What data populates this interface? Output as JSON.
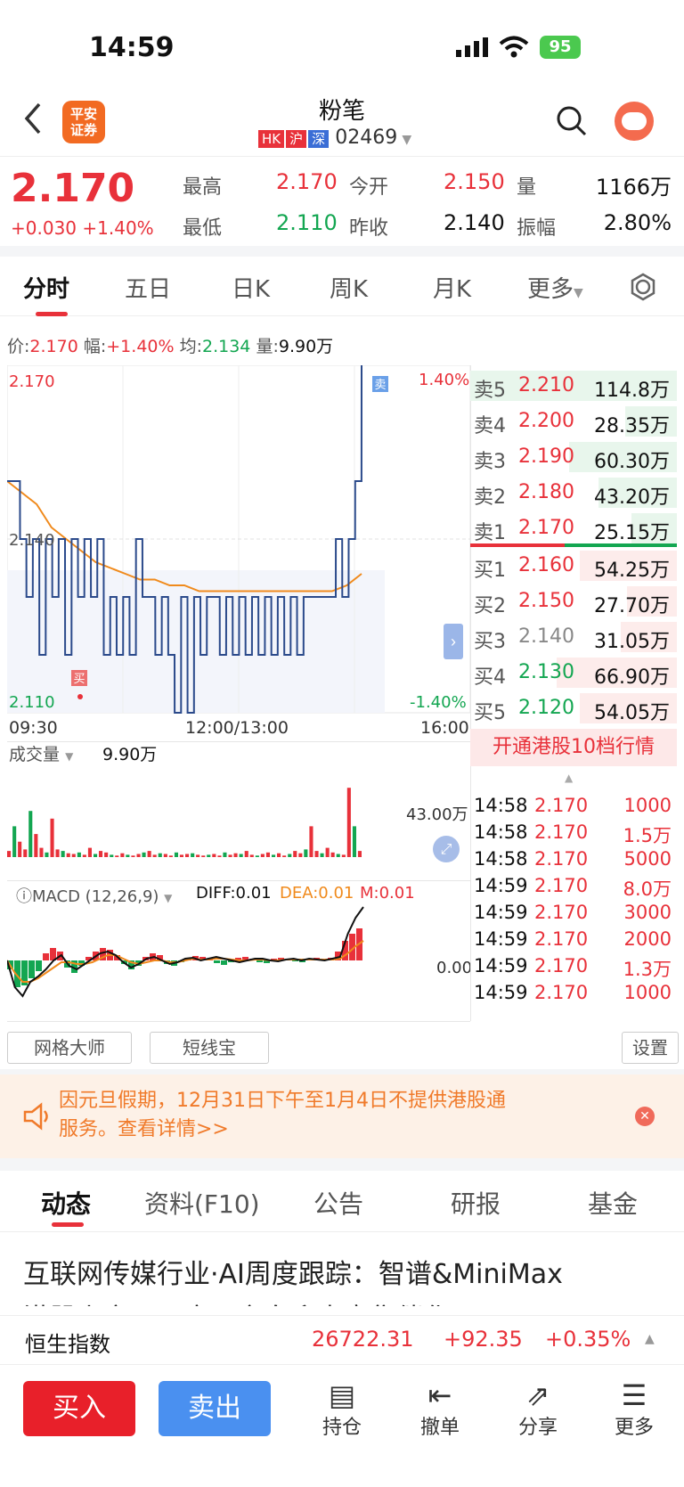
{
  "status": {
    "time": "14:59",
    "battery": "95"
  },
  "header": {
    "title": "粉笔",
    "logo_line1": "平安",
    "logo_line2": "证券",
    "tags": [
      "HK",
      "沪",
      "深"
    ],
    "code": "02469"
  },
  "quote": {
    "price": "2.170",
    "change": "+0.030",
    "change_pct": "+1.40%",
    "labels": {
      "high": "最高",
      "low": "最低",
      "open": "今开",
      "prev": "昨收",
      "volume": "量",
      "amplitude": "振幅"
    },
    "high": "2.170",
    "low": "2.110",
    "open": "2.150",
    "prev": "2.140",
    "volume": "1166万",
    "amplitude": "2.80%"
  },
  "tabs": [
    "分时",
    "五日",
    "日K",
    "周K",
    "月K",
    "更多"
  ],
  "chart_info": {
    "price_label": "价:",
    "price": "2.170",
    "amp_label": "幅:",
    "amp": "+1.40%",
    "avg_label": "均:",
    "avg": "2.134",
    "vol_label": "量:",
    "vol": "9.90万"
  },
  "chart_axes": {
    "y_top": "2.170",
    "y_mid": "2.140",
    "y_bottom": "2.110",
    "pct_top": "1.40%",
    "pct_bottom": "-1.40%",
    "x_start": "09:30",
    "x_mid": "12:00/13:00",
    "x_end": "16:00",
    "sell_marker": "卖",
    "buy_marker": "买"
  },
  "volume_panel": {
    "label": "成交量",
    "value": "9.90万",
    "max": "43.00万"
  },
  "macd": {
    "label": "MACD (12,26,9)",
    "diff": "DIFF:0.01",
    "dea": "DEA:0.01",
    "m": "M:0.01",
    "zero": "0.00"
  },
  "order_book": {
    "sell": [
      {
        "label": "卖5",
        "price": "2.210",
        "vol": "114.8万",
        "depth": 1.0
      },
      {
        "label": "卖4",
        "price": "2.200",
        "vol": "28.35万",
        "depth": 0.25
      },
      {
        "label": "卖3",
        "price": "2.190",
        "vol": "60.30万",
        "depth": 0.52
      },
      {
        "label": "卖2",
        "price": "2.180",
        "vol": "43.20万",
        "depth": 0.38
      },
      {
        "label": "卖1",
        "price": "2.170",
        "vol": "25.15万",
        "depth": 0.22
      }
    ],
    "buy": [
      {
        "label": "买1",
        "price": "2.160",
        "vol": "54.25万",
        "depth": 0.47
      },
      {
        "label": "买2",
        "price": "2.150",
        "vol": "27.70万",
        "depth": 0.24
      },
      {
        "label": "买3",
        "price": "2.140",
        "vol": "31.05万",
        "depth": 0.27
      },
      {
        "label": "买4",
        "price": "2.130",
        "vol": "66.90万",
        "depth": 0.58
      },
      {
        "label": "买5",
        "price": "2.120",
        "vol": "54.05万",
        "depth": 0.47
      }
    ],
    "promo": "开通港股10档行情"
  },
  "trades": [
    {
      "t": "14:58",
      "p": "2.170",
      "v": "1000"
    },
    {
      "t": "14:58",
      "p": "2.170",
      "v": "1.5万"
    },
    {
      "t": "14:58",
      "p": "2.170",
      "v": "5000"
    },
    {
      "t": "14:59",
      "p": "2.170",
      "v": "8.0万"
    },
    {
      "t": "14:59",
      "p": "2.170",
      "v": "3000"
    },
    {
      "t": "14:59",
      "p": "2.170",
      "v": "2000"
    },
    {
      "t": "14:59",
      "p": "2.170",
      "v": "1.3万"
    },
    {
      "t": "14:59",
      "p": "2.170",
      "v": "1000"
    }
  ],
  "tools": {
    "grid": "网格大师",
    "short": "短线宝",
    "settings": "设置"
  },
  "notice": {
    "line1": "因元旦假期，12月31日下午至1月4日不提供港股通",
    "line2": "服务。查看详情>>"
  },
  "bottom_tabs": [
    "动态",
    "资料(F10)",
    "公告",
    "研报",
    "基金"
  ],
  "news": {
    "line1": "互联网传媒行业·AI周度跟踪：智谱&MiniMax",
    "line2": "港股上市，AI应用方向迎来密集催化"
  },
  "index_bar": {
    "name": "恒生指数",
    "value": "26722.31",
    "change": "+92.35",
    "pct": "+0.35%"
  },
  "actions": {
    "buy": "买入",
    "sell": "卖出",
    "hold": "持仓",
    "cancel": "撤单",
    "share": "分享",
    "more": "更多"
  },
  "colors": {
    "up": "#e8313a",
    "down": "#13a651",
    "price_line": "#2b4a8b",
    "avg_line": "#f08a1c",
    "buy_btn": "#e8202a",
    "sell_btn": "#4a90f0"
  }
}
